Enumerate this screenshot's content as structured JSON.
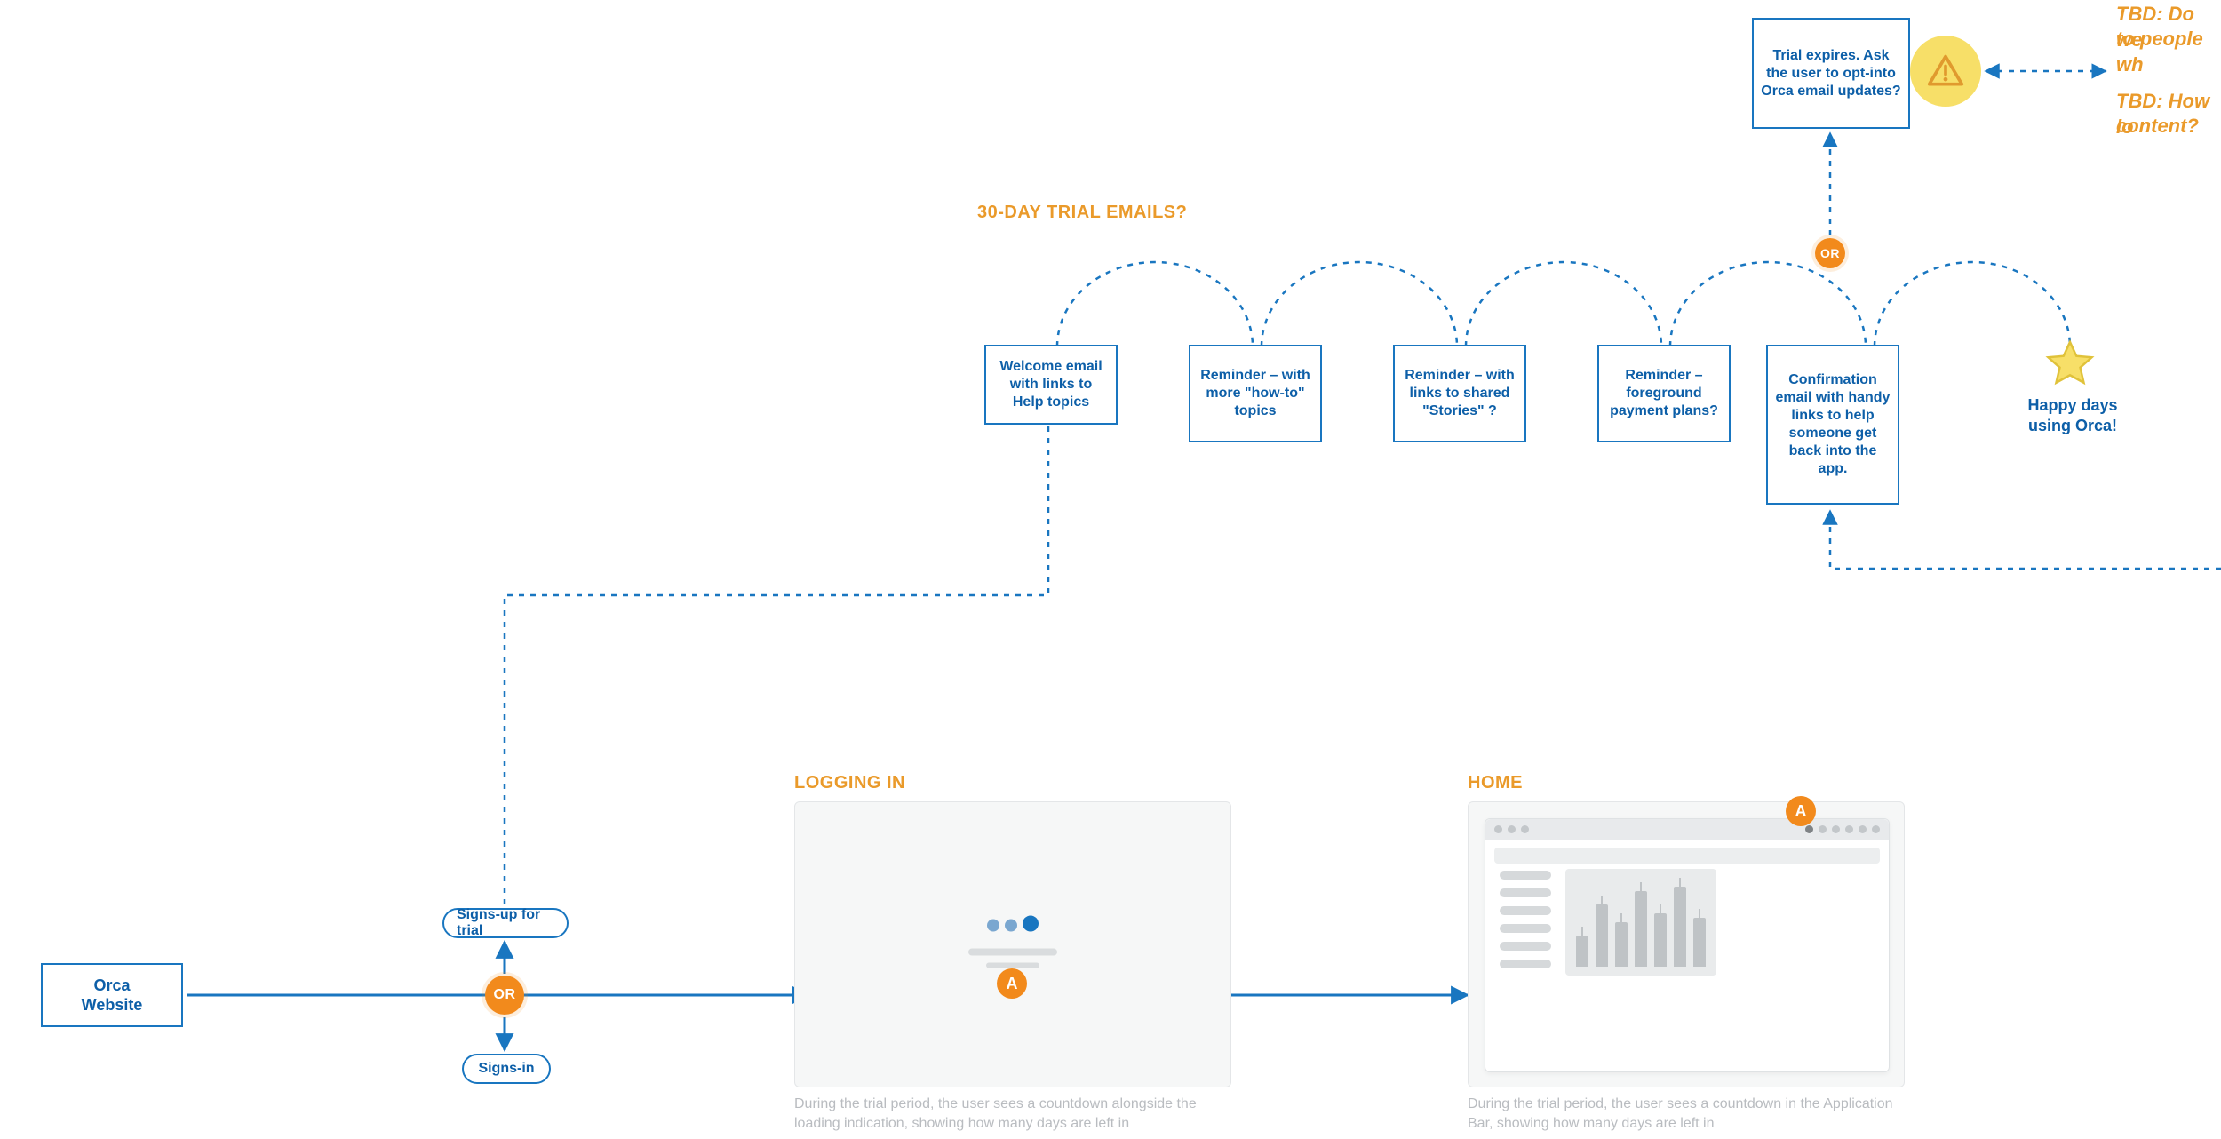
{
  "colors": {
    "blue": "#1976c0",
    "blue_text": "#0d5fa8",
    "orange": "#f28a1c",
    "orange_text": "#ea9a2a",
    "mock_bg": "#f6f7f7",
    "grey_text": "#b9bcc0"
  },
  "headings": {
    "trial_emails": "30-DAY TRIAL EMAILS?",
    "logging_in": "LOGGING IN",
    "home": "HOME"
  },
  "start_box": {
    "line1": "Orca",
    "line2": "Website"
  },
  "or_label": "OR",
  "marker_a": "A",
  "pills": {
    "signup": "Signs-up for trial",
    "signin": "Signs-in"
  },
  "emails": [
    "Welcome email with links\nto Help topics",
    "Reminder – with more \"how-to\" topics",
    "Reminder – with links to shared \"Stories\" ?",
    "Reminder – foreground payment plans?",
    "Confirmation email\nwith handy links to help someone get back into the app."
  ],
  "expire_box": "Trial expires. Ask the user to opt-into Orca email updates?",
  "happy_label": "Happy days using Orca!",
  "tbd": {
    "a": "TBD: Do we",
    "a2": "to people wh",
    "b": "TBD: How lo",
    "b2": "content?"
  },
  "captions": {
    "logging_in": "During the trial period, the user sees a countdown alongside the loading indication, showing how many days are left in",
    "home": "During the trial period, the user sees a countdown in the Application Bar, showing how many days are left in"
  }
}
